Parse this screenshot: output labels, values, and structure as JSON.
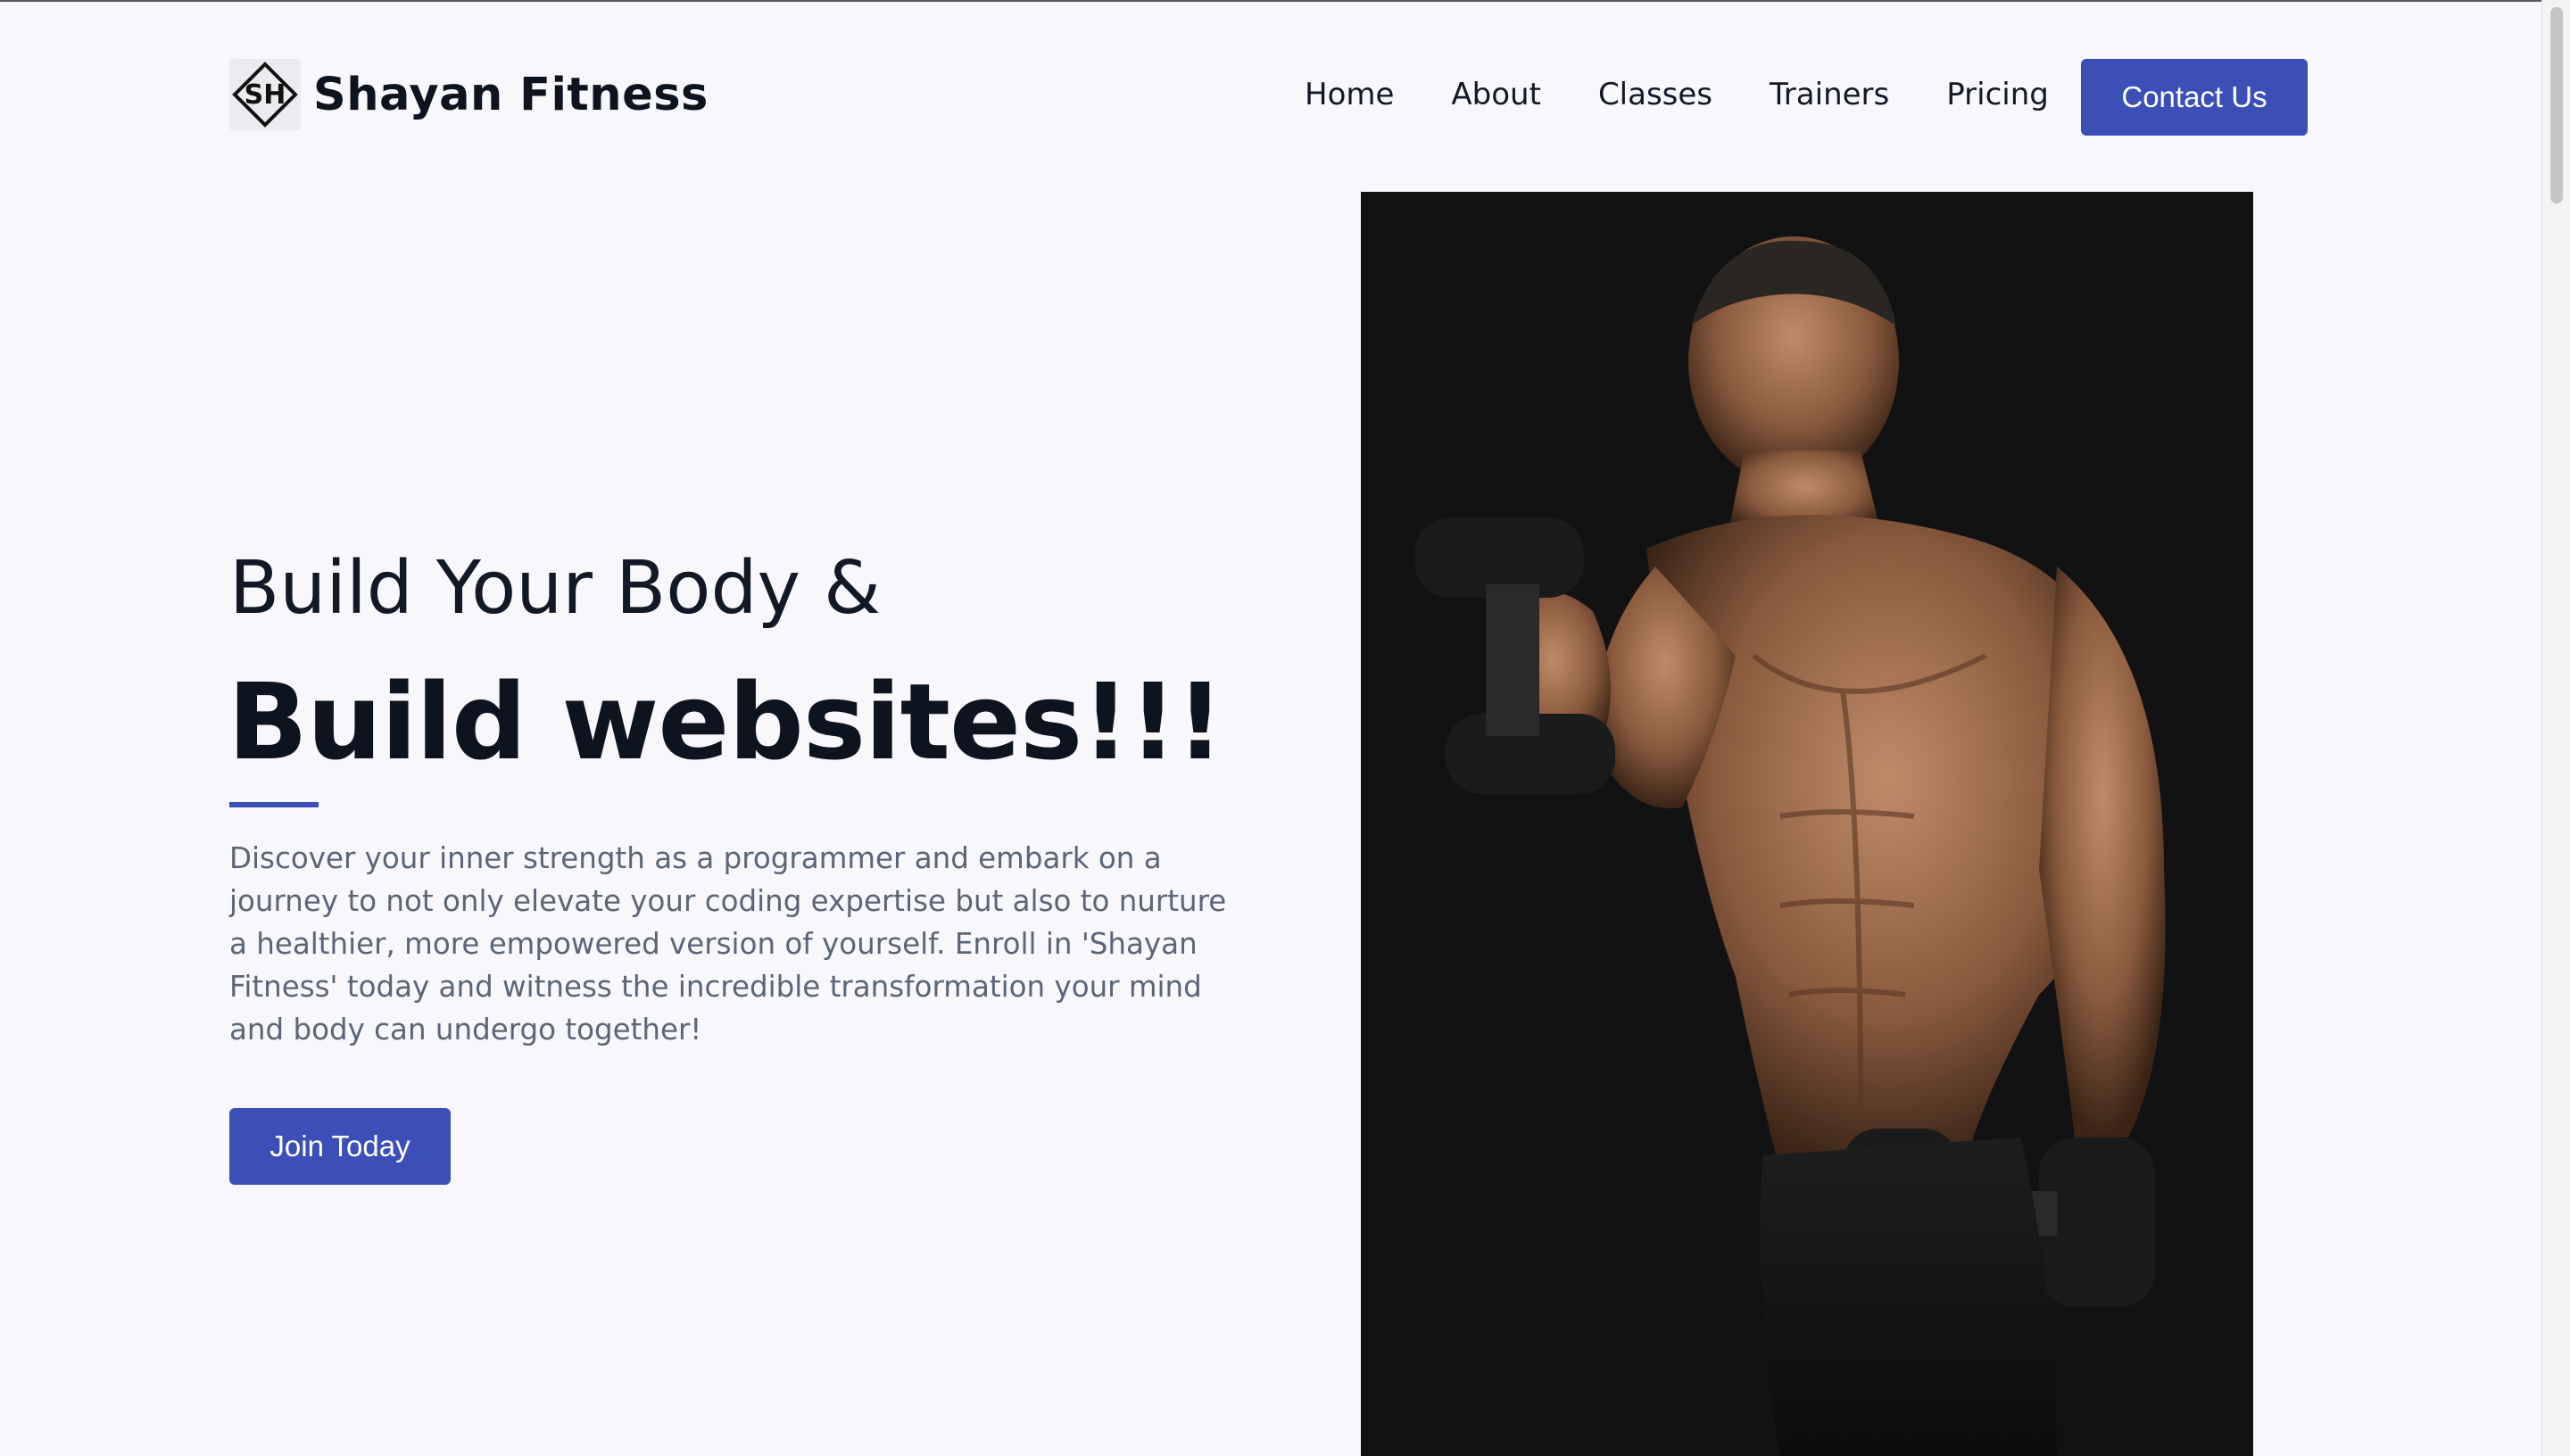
{
  "brand": {
    "logo_text": "SH",
    "name": "Shayan Fitness"
  },
  "nav": {
    "items": [
      "Home",
      "About",
      "Classes",
      "Trainers",
      "Pricing"
    ],
    "cta_label": "Contact Us"
  },
  "hero": {
    "line1": "Build Your Body &",
    "line2": "Build websites!!!",
    "description": "Discover your inner strength as a programmer and embark on a journey to not only elevate your coding expertise but also to nurture a healthier, more empowered version of yourself. Enroll in 'Shayan Fitness' today and witness the incredible transformation your mind and body can undergo together!",
    "button_label": "Join Today",
    "image_alt": "muscular man lifting dumbbells"
  },
  "colors": {
    "accent": "#3c4fb7",
    "background": "#f8f8fc",
    "heading": "#0e1320",
    "body_text": "#5b6578",
    "photo_bg": "#121212"
  }
}
